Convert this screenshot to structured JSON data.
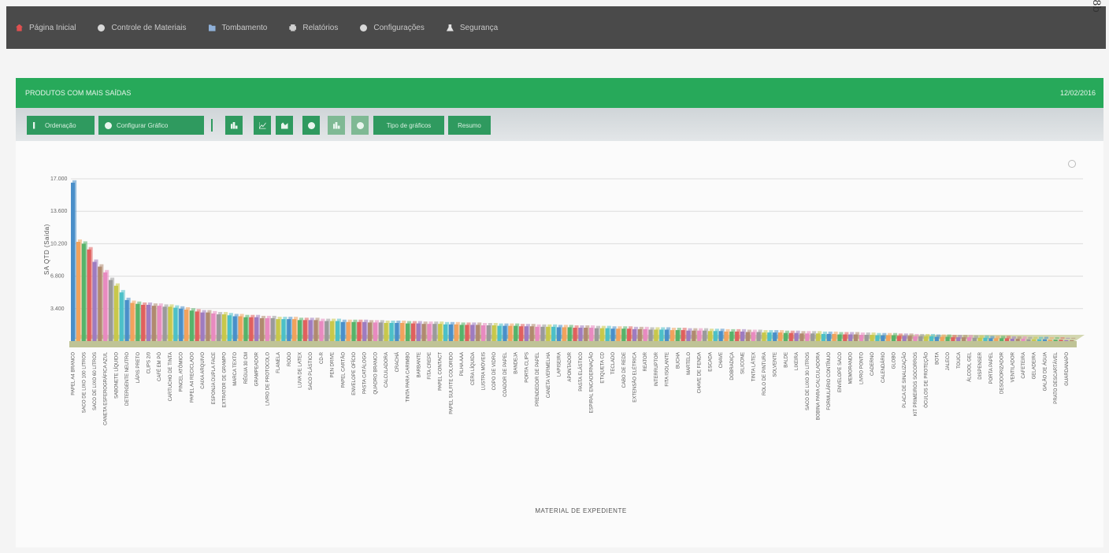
{
  "nav": {
    "items": [
      {
        "label": "Página Inicial",
        "icon": "home-icon"
      },
      {
        "label": "Controle de Materiais",
        "icon": "circle-icon"
      },
      {
        "label": "Tombamento",
        "icon": "folder-icon"
      },
      {
        "label": "Relatórios",
        "icon": "print-icon"
      },
      {
        "label": "Configurações",
        "icon": "gear-icon"
      },
      {
        "label": "Segurança",
        "icon": "user-icon"
      }
    ],
    "corner_digit": "8b"
  },
  "panel": {
    "title": "PRODUTOS COM MAIS SAÍDAS",
    "date": "12/02/2016"
  },
  "toolbar": {
    "ordenacao_label": "Ordenação",
    "configurar_label": "Configurar Gráfico",
    "tipo_label": "Tipo de gráficos",
    "resumo_label": "Resumo"
  },
  "colors": {
    "nav_bg": "#4a4a4a",
    "accent_green": "#27a95a",
    "button_green": "#2f9a5f"
  },
  "chart_data": {
    "type": "bar",
    "three_d": true,
    "xlabel": "MATERIAL DE EXPEDIENTE",
    "ylabel": "SA QTD (Saída)",
    "yticks": [
      "17.000",
      "13.600",
      "10.200",
      "6.800",
      "3.400"
    ],
    "ylim": [
      0,
      17000
    ],
    "grid": true,
    "categories": [
      "PAPEL A4 BRANCO",
      "COPO DESCARTÁVEL 200ML",
      "SACO DE LIXO 100 LITROS",
      "COPO DESC. 50ML CAFÉ",
      "SACO DE LIXO 60 LITROS",
      "PAPEL TOALHA INTERFOLHA",
      "CANETA ESFEROGRÁFICA AZUL",
      "PAPEL HIGIÊNICO",
      "SABONETE LÍQUIDO",
      "ENVELOPE PARDO A4",
      "DETERGENTE NEUTRO",
      "PASTA SUSPENSA",
      "LÁPIS PRETO",
      "BORRACHA BRANCA",
      "CLIPS 2/0",
      "GRAMPO 26/6",
      "CAFÉ EM PÓ",
      "AÇÚCAR CRISTAL",
      "CARTUCHO DE TINTA",
      "FITA ADESIVA",
      "PINCEL ATÔMICO",
      "COLA BRANCA",
      "PAPEL A4 RECICLADO",
      "BLOCO DE RECADO",
      "CAIXA ARQUIVO",
      "ÁGUA SANITÁRIA",
      "ESPONJA DUPLA FACE",
      "CORRETIVO LÍQUIDO",
      "EXTRATOR DE GRAMPO",
      "PERCEVEJO",
      "MARCA TEXTO",
      "TESOURA",
      "RÉGUA 30 CM",
      "PERFURADOR",
      "GRAMPEADOR",
      "ETIQUETA ADESIVA",
      "LIVRO DE PROTOCOLO",
      "ÁLCOOL 70%",
      "FLANELA",
      "VASSOURA",
      "RODO",
      "PANO DE CHÃO",
      "LUVA DE LATEX",
      "DESINFETANTE",
      "SACO PLÁSTICO",
      "PILHA AA",
      "CD-R",
      "DVD-R",
      "PEN DRIVE",
      "TONER",
      "PAPEL CARTÃO",
      "CARTOLINA",
      "ENVELOPE OFÍCIO",
      "PASTA AZ",
      "PASTA CATÁLOGO",
      "CAIXA DE CORRESPONDÊNCIA",
      "QUADRO BRANCO",
      "APAGADOR",
      "CALCULADORA",
      "CORDÃO PARA CRACHÁ",
      "CRACHÁ",
      "ALMOFADA CARIMBO",
      "TINTA PARA CARIMBO",
      "ELÁSTICO",
      "BARBANTE",
      "LACRE",
      "FITA CREPE",
      "FITA DUPLA FACE",
      "PAPEL CONTACT",
      "PAPEL MANILHA",
      "PAPEL SULFITE COLORIDO",
      "BLOCO FLIP CHART",
      "PILHA AAA",
      "LIMPA VIDROS",
      "CERA LÍQUIDA",
      "SABÃO EM PÓ",
      "LUSTRA MÓVEIS",
      "INSETICIDA",
      "COPO DE VIDRO",
      "GARRAFA TÉRMICA",
      "COADOR DE PAPEL",
      "FILTRO DE CAFÉ",
      "BANDEJA",
      "PORTA LÁPIS",
      "PORTA CLIPS",
      "UMEDECEDOR",
      "PRENDEDOR DE PAPEL",
      "GRAMPO TRILHO",
      "CANETA VERMELHA",
      "CANETA PRETA",
      "LAPISEIRA",
      "GRAFITE",
      "APONTADOR",
      "PASTA L",
      "PASTA ELÁSTICO",
      "CAPA PARA ENCADERNAÇÃO",
      "ESPIRAL ENCADERNAÇÃO",
      "PAPEL FOTOGRÁFICO",
      "ETIQUETA CD",
      "MOUSE PAD",
      "TECLADO",
      "MOUSE",
      "CABO DE REDE",
      "FONE DE OUVIDO",
      "EXTENSÃO ELÉTRICA",
      "LÂMPADA",
      "REATOR",
      "TOMADA",
      "INTERRUPTOR",
      "FIO ELÉTRICO",
      "FITA ISOLANTE",
      "PARAFUSO",
      "BUCHA",
      "PREGO",
      "MARTELO",
      "ALICATE",
      "CHAVE DE FENDA",
      "TRENA",
      "ESCADA",
      "CADEADO",
      "CHAVE",
      "FECHADURA",
      "DOBRADIÇA",
      "COLA INSTANTÂNEA",
      "SILICONE",
      "MASSA CORRIDA",
      "TINTA LÁTEX",
      "PINCEL",
      "ROLO DE PINTURA",
      "LIXA",
      "SOLVENTE",
      "ESTOPA",
      "BALDE",
      "PÁ DE LIXO",
      "LIXEIRA",
      "CESTO DE LIXO",
      "SACO DE LIXO 30 LITROS",
      "PAPEL KRAFT",
      "BOBINA PARA CALCULADORA",
      "BOBINA TÉRMICA",
      "FORMULÁRIO CONTÍNUO",
      "ENVELOPE CARTA",
      "ENVELOPE SACO",
      "ETIQUETA PIMACO",
      "MEMORANDO",
      "OFÍCIO",
      "LIVRO PONTO",
      "LIVRO ATA",
      "CADERNO",
      "AGENDA",
      "CALENDÁRIO",
      "MAPA",
      "GLOBO",
      "BANDEIRA",
      "PLACA DE SINALIZAÇÃO",
      "EXTINTOR",
      "KIT PRIMEIROS SOCORROS",
      "PROTETOR AURICULAR",
      "ÓCULOS DE PROTEÇÃO",
      "CAPACETE",
      "BOTA",
      "UNIFORME",
      "JALECO",
      "AVENTAL",
      "TOUCA",
      "MÁSCARA",
      "ÁLCOOL GEL",
      "PAPEL TOALHA BOBINA",
      "DISPENSER",
      "SABONETEIRA",
      "PORTA PAPEL",
      "ESPELHO",
      "DESODORIZADOR",
      "PURIFICADOR DE AR",
      "VENTILADOR",
      "AQUECEDOR",
      "CAFETEIRA",
      "MICRO-ONDAS",
      "GELADEIRA",
      "BEBEDOURO",
      "GALÃO DE ÁGUA",
      "COPO DESC. 300ML",
      "PRATO DESCARTÁVEL",
      "TALHER DESCARTÁVEL",
      "GUARDANAPO",
      "TOALHA DE MESA"
    ],
    "values": [
      16600,
      10400,
      10200,
      9600,
      8300,
      7800,
      7200,
      6400,
      5800,
      5100,
      4300,
      4000,
      3900,
      3800,
      3800,
      3700,
      3700,
      3600,
      3600,
      3500,
      3400,
      3300,
      3200,
      3100,
      3000,
      3000,
      2900,
      2800,
      2800,
      2700,
      2600,
      2600,
      2500,
      2500,
      2500,
      2400,
      2400,
      2400,
      2300,
      2300,
      2300,
      2300,
      2200,
      2200,
      2200,
      2200,
      2100,
      2100,
      2100,
      2100,
      2000,
      2000,
      2000,
      2000,
      2000,
      1950,
      1950,
      1950,
      1900,
      1900,
      1900,
      1900,
      1850,
      1850,
      1850,
      1800,
      1800,
      1800,
      1800,
      1750,
      1750,
      1750,
      1700,
      1700,
      1700,
      1700,
      1650,
      1650,
      1650,
      1600,
      1600,
      1600,
      1600,
      1550,
      1550,
      1550,
      1500,
      1500,
      1500,
      1500,
      1450,
      1450,
      1450,
      1400,
      1400,
      1400,
      1400,
      1350,
      1350,
      1350,
      1300,
      1300,
      1300,
      1300,
      1250,
      1250,
      1250,
      1200,
      1200,
      1200,
      1200,
      1150,
      1150,
      1150,
      1100,
      1100,
      1100,
      1100,
      1050,
      1050,
      1050,
      1000,
      1000,
      1000,
      1000,
      950,
      950,
      950,
      900,
      900,
      900,
      900,
      850,
      850,
      850,
      800,
      800,
      800,
      800,
      750,
      750,
      750,
      700,
      700,
      700,
      700,
      650,
      650,
      650,
      600,
      600,
      600,
      600,
      550,
      550,
      550,
      500,
      500,
      500,
      500,
      450,
      450,
      450,
      400,
      400,
      400,
      400,
      350,
      350,
      350,
      300,
      300,
      300,
      300,
      250,
      250,
      250,
      200,
      200,
      200,
      200,
      150,
      150,
      150,
      100,
      100
    ],
    "palette": [
      "#4a8fc9",
      "#f2a25c",
      "#56b36a",
      "#e0605e",
      "#9e7bc0",
      "#b08a6f",
      "#e88ac0",
      "#9a9a9a",
      "#c8c84a",
      "#4cc0c8"
    ]
  }
}
